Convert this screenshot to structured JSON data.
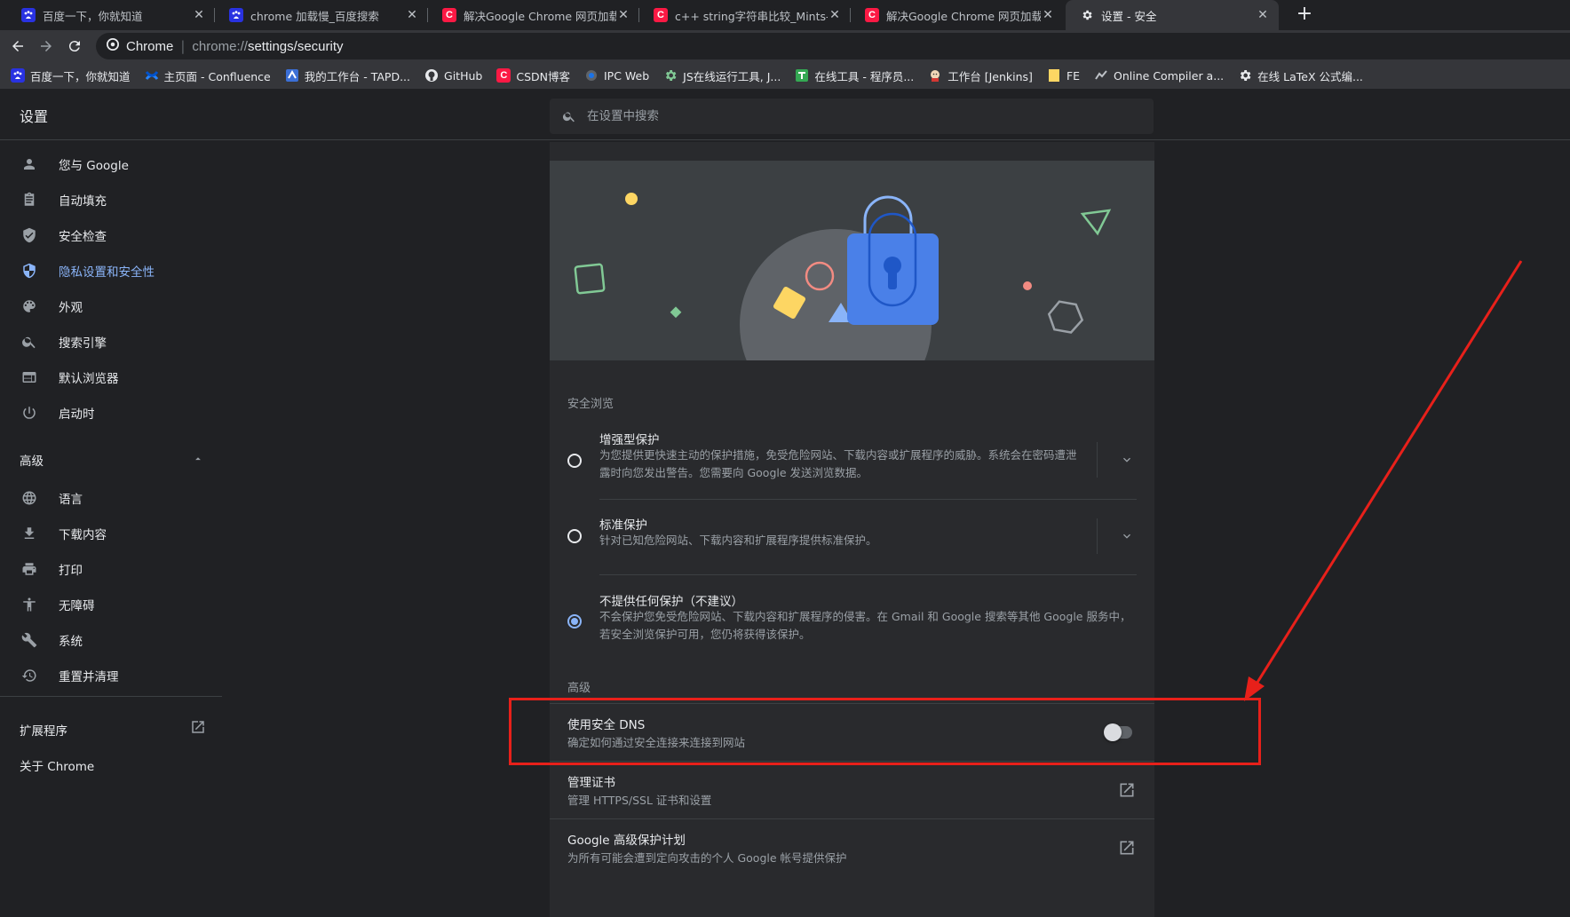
{
  "tabs": [
    {
      "title": "百度一下，你就知道",
      "favicon": "baidu-icon"
    },
    {
      "title": "chrome 加载慢_百度搜索",
      "favicon": "baidu-icon"
    },
    {
      "title": "解决Google Chrome 网页加载",
      "favicon": "csdn-icon"
    },
    {
      "title": "c++ string字符串比较_Mints-C",
      "favicon": "csdn-icon"
    },
    {
      "title": "解决Google Chrome 网页加载",
      "favicon": "csdn-icon"
    },
    {
      "title": "设置 - 安全",
      "favicon": "gear-icon",
      "active": true
    }
  ],
  "omnibox": {
    "site_name": "Chrome",
    "divider": "|",
    "scheme": "chrome://",
    "path": "settings/security"
  },
  "bookmarks": [
    {
      "label": "百度一下，你就知道",
      "icon": "baidu-icon"
    },
    {
      "label": "主页面 - Confluence",
      "icon": "confluence-icon"
    },
    {
      "label": "我的工作台 - TAPD...",
      "icon": "tapd-icon"
    },
    {
      "label": "GitHub",
      "icon": "github-icon"
    },
    {
      "label": "CSDN博客",
      "icon": "csdn-icon"
    },
    {
      "label": "IPC Web",
      "icon": "ipc-icon"
    },
    {
      "label": "JS在线运行工具, J...",
      "icon": "gear-green-icon"
    },
    {
      "label": "在线工具 - 程序员...",
      "icon": "tool-icon"
    },
    {
      "label": "工作台 [Jenkins]",
      "icon": "jenkins-icon"
    },
    {
      "label": "FE",
      "icon": "folder-icon"
    },
    {
      "label": "Online Compiler a...",
      "icon": "compiler-icon"
    },
    {
      "label": "在线 LaTeX 公式编...",
      "icon": "gear-icon"
    }
  ],
  "header": {
    "title": "设置",
    "search_placeholder": "在设置中搜索"
  },
  "sidebar": {
    "items": [
      {
        "label": "您与 Google",
        "icon": "person-icon"
      },
      {
        "label": "自动填充",
        "icon": "clipboard-icon"
      },
      {
        "label": "安全检查",
        "icon": "shield-check-icon"
      },
      {
        "label": "隐私设置和安全性",
        "icon": "shield-privacy-icon",
        "active": true
      },
      {
        "label": "外观",
        "icon": "palette-icon"
      },
      {
        "label": "搜索引擎",
        "icon": "search-icon"
      },
      {
        "label": "默认浏览器",
        "icon": "browser-icon"
      },
      {
        "label": "启动时",
        "icon": "power-icon"
      }
    ],
    "advanced_label": "高级",
    "advanced_items": [
      {
        "label": "语言",
        "icon": "globe-icon"
      },
      {
        "label": "下载内容",
        "icon": "download-icon"
      },
      {
        "label": "打印",
        "icon": "printer-icon"
      },
      {
        "label": "无障碍",
        "icon": "accessibility-icon"
      },
      {
        "label": "系统",
        "icon": "wrench-icon"
      },
      {
        "label": "重置并清理",
        "icon": "restore-icon"
      }
    ],
    "extensions_label": "扩展程序",
    "about_label": "关于 Chrome"
  },
  "safe_browsing": {
    "title": "安全浏览",
    "options": [
      {
        "label": "增强型保护",
        "desc": "为您提供更快速主动的保护措施，免受危险网站、下载内容或扩展程序的威胁。系统会在密码遭泄露时向您发出警告。您需要向 Google 发送浏览数据。",
        "checked": false
      },
      {
        "label": "标准保护",
        "desc": "针对已知危险网站、下载内容和扩展程序提供标准保护。",
        "checked": false
      },
      {
        "label": "不提供任何保护（不建议）",
        "desc": "不会保护您免受危险网站、下载内容和扩展程序的侵害。在 Gmail 和 Google 搜索等其他 Google 服务中，若安全浏览保护可用，您仍将获得该保护。",
        "checked": true
      }
    ]
  },
  "advanced": {
    "title": "高级",
    "rows": [
      {
        "label": "使用安全 DNS",
        "desc": "确定如何通过安全连接来连接到网站",
        "toggle_on": false
      },
      {
        "label": "管理证书",
        "desc": "管理 HTTPS/SSL 证书和设置"
      },
      {
        "label": "Google 高级保护计划",
        "desc": "为所有可能会遭到定向攻击的个人 Google 帐号提供保护"
      }
    ]
  },
  "colors": {
    "accent": "#8ab4f8",
    "annotation": "#e8201a",
    "background": "#202124",
    "card": "#292a2d"
  }
}
